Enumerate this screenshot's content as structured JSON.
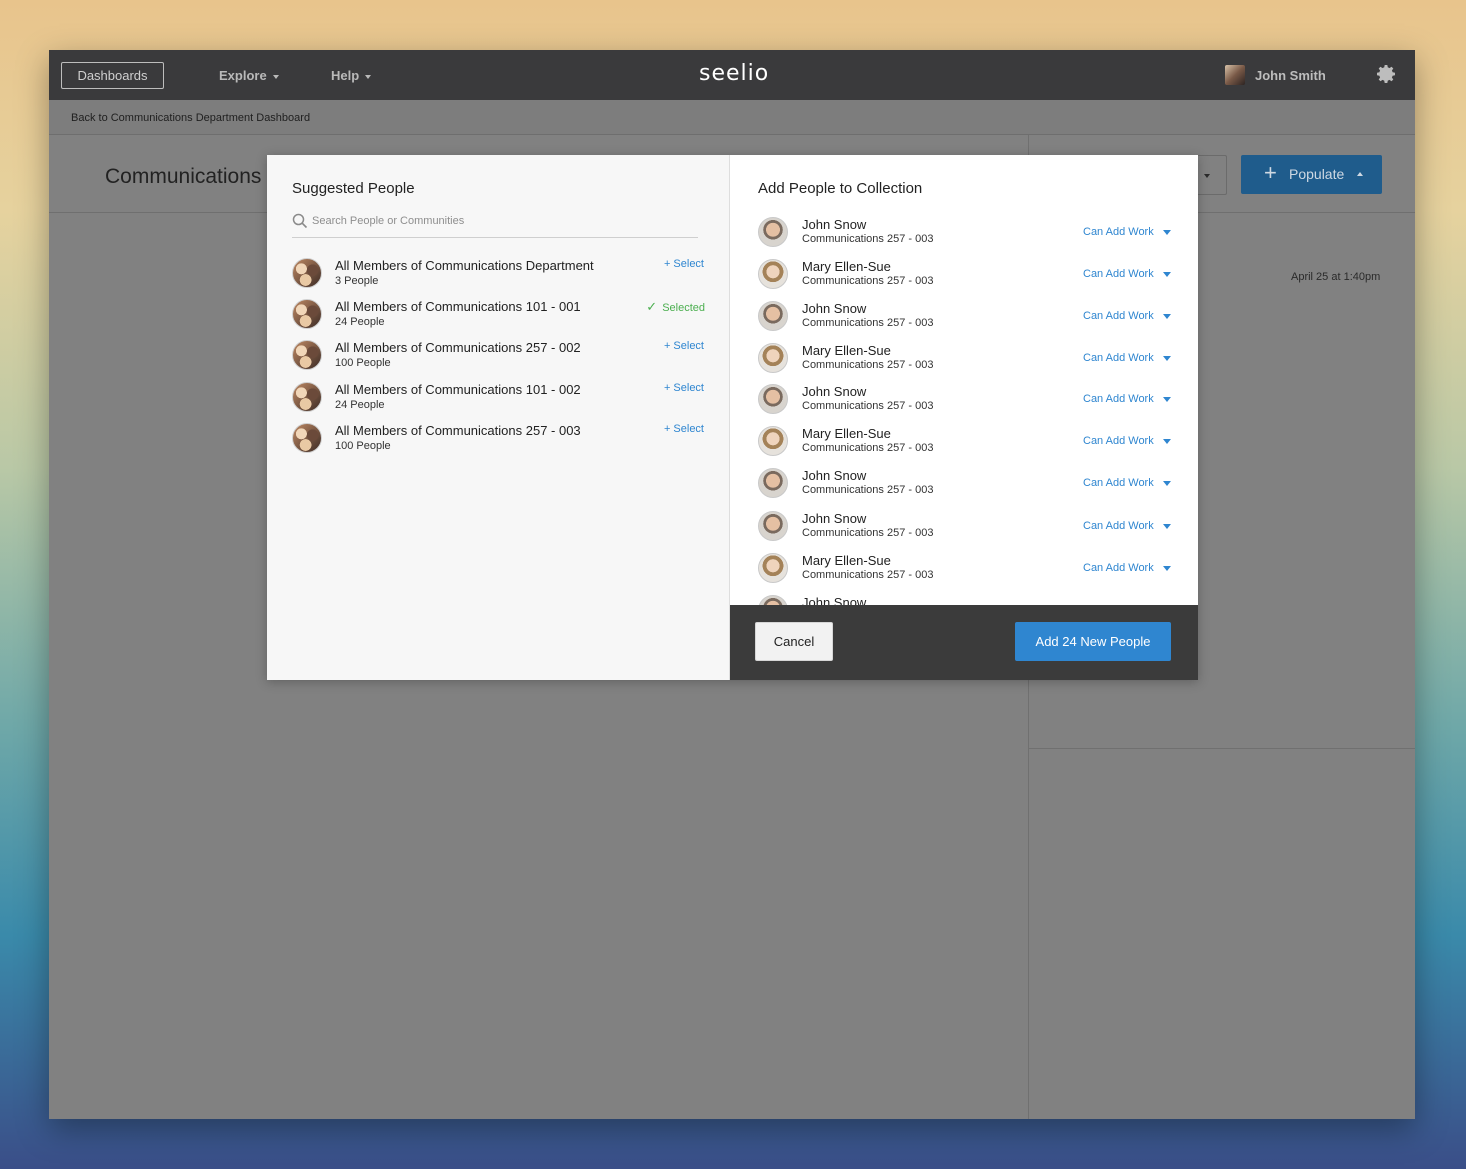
{
  "app": {
    "logo": "seelio",
    "nav": {
      "dashboards": "Dashboards",
      "explore": "Explore",
      "help": "Help"
    },
    "user": {
      "name": "John Smith"
    }
  },
  "breadcrumb": {
    "back_label": "Back to Communications Department Dashboard"
  },
  "page": {
    "title": "Communications",
    "populate_label": "Populate",
    "timestamp": "April 25 at 1:40pm"
  },
  "modal": {
    "suggested": {
      "title": "Suggested People",
      "search_placeholder": "Search People or Communities",
      "items": [
        {
          "name": "All Members of Communications Department",
          "count": "3 People",
          "action": "+ Select",
          "selected": false
        },
        {
          "name": "All Members of Communications 101 - 001",
          "count": "24 People",
          "action": "Selected",
          "selected": true
        },
        {
          "name": "All Members of Communications 257 - 002",
          "count": "100 People",
          "action": "+ Select",
          "selected": false
        },
        {
          "name": "All Members of Communications 101 - 002",
          "count": "24 People",
          "action": "+ Select",
          "selected": false
        },
        {
          "name": "All Members of Communications 257 - 003",
          "count": "100 People",
          "action": "+ Select",
          "selected": false
        }
      ]
    },
    "collection": {
      "title": "Add People to Collection",
      "people": [
        {
          "name": "John Snow",
          "group": "Communications 257 - 003",
          "permission": "Can Add Work",
          "avatar": "male"
        },
        {
          "name": "Mary Ellen-Sue",
          "group": "Communications 257 - 003",
          "permission": "Can Add Work",
          "avatar": "female"
        },
        {
          "name": "John Snow",
          "group": "Communications 257 - 003",
          "permission": "Can Add Work",
          "avatar": "male"
        },
        {
          "name": "Mary Ellen-Sue",
          "group": "Communications 257 - 003",
          "permission": "Can Add Work",
          "avatar": "female"
        },
        {
          "name": "John Snow",
          "group": "Communications 257 - 003",
          "permission": "Can Add Work",
          "avatar": "male"
        },
        {
          "name": "Mary Ellen-Sue",
          "group": "Communications 257 - 003",
          "permission": "Can Add Work",
          "avatar": "female"
        },
        {
          "name": "John Snow",
          "group": "Communications 257 - 003",
          "permission": "Can Add Work",
          "avatar": "male"
        },
        {
          "name": "John Snow",
          "group": "Communications 257 - 003",
          "permission": "Can Add Work",
          "avatar": "male"
        },
        {
          "name": "Mary Ellen-Sue",
          "group": "Communications 257 - 003",
          "permission": "Can Add Work",
          "avatar": "female"
        },
        {
          "name": "John Snow",
          "group": "",
          "permission": "",
          "avatar": "male"
        }
      ],
      "cancel_label": "Cancel",
      "add_label": "Add 24 New People"
    }
  },
  "colors": {
    "accent": "#2f86d0",
    "selected": "#4caf50",
    "topbar": "#3a3a3c",
    "footer": "#3b3b3b"
  }
}
